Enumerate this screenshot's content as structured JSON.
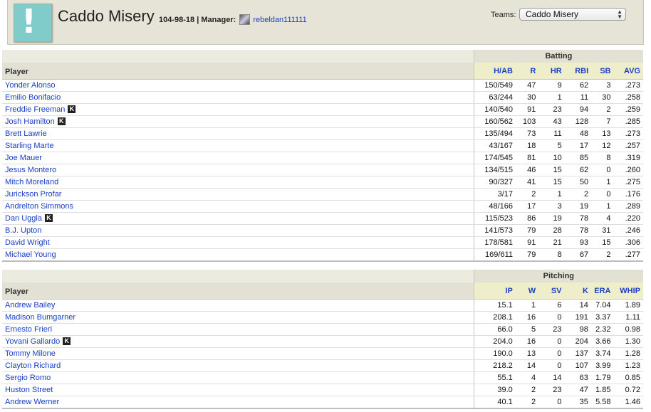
{
  "header": {
    "team_name": "Caddo Misery",
    "record": "104-98-18",
    "separator": "|",
    "manager_label": "Manager:",
    "manager_name": "rebeldan111111",
    "logo_glyph": "!",
    "teams_label": "Teams:",
    "teams_selected": "Caddo Misery"
  },
  "batting": {
    "group_label": "Batting",
    "player_header": "Player",
    "columns": [
      "H/AB",
      "R",
      "HR",
      "RBI",
      "SB",
      "AVG"
    ],
    "rows": [
      {
        "name": "Yonder Alonso",
        "k": false,
        "stats": [
          "150/549",
          "47",
          "9",
          "62",
          "3",
          ".273"
        ]
      },
      {
        "name": "Emilio Bonifacio",
        "k": false,
        "stats": [
          "63/244",
          "30",
          "1",
          "11",
          "30",
          ".258"
        ]
      },
      {
        "name": "Freddie Freeman",
        "k": true,
        "stats": [
          "140/540",
          "91",
          "23",
          "94",
          "2",
          ".259"
        ]
      },
      {
        "name": "Josh Hamilton",
        "k": true,
        "stats": [
          "160/562",
          "103",
          "43",
          "128",
          "7",
          ".285"
        ]
      },
      {
        "name": "Brett Lawrie",
        "k": false,
        "stats": [
          "135/494",
          "73",
          "11",
          "48",
          "13",
          ".273"
        ]
      },
      {
        "name": "Starling Marte",
        "k": false,
        "stats": [
          "43/167",
          "18",
          "5",
          "17",
          "12",
          ".257"
        ]
      },
      {
        "name": "Joe Mauer",
        "k": false,
        "stats": [
          "174/545",
          "81",
          "10",
          "85",
          "8",
          ".319"
        ]
      },
      {
        "name": "Jesus Montero",
        "k": false,
        "stats": [
          "134/515",
          "46",
          "15",
          "62",
          "0",
          ".260"
        ]
      },
      {
        "name": "Mitch Moreland",
        "k": false,
        "stats": [
          "90/327",
          "41",
          "15",
          "50",
          "1",
          ".275"
        ]
      },
      {
        "name": "Jurickson Profar",
        "k": false,
        "stats": [
          "3/17",
          "2",
          "1",
          "2",
          "0",
          ".176"
        ]
      },
      {
        "name": "Andrelton Simmons",
        "k": false,
        "stats": [
          "48/166",
          "17",
          "3",
          "19",
          "1",
          ".289"
        ]
      },
      {
        "name": "Dan Uggla",
        "k": true,
        "stats": [
          "115/523",
          "86",
          "19",
          "78",
          "4",
          ".220"
        ]
      },
      {
        "name": "B.J. Upton",
        "k": false,
        "stats": [
          "141/573",
          "79",
          "28",
          "78",
          "31",
          ".246"
        ]
      },
      {
        "name": "David Wright",
        "k": false,
        "stats": [
          "178/581",
          "91",
          "21",
          "93",
          "15",
          ".306"
        ]
      },
      {
        "name": "Michael Young",
        "k": false,
        "stats": [
          "169/611",
          "79",
          "8",
          "67",
          "2",
          ".277"
        ]
      }
    ]
  },
  "pitching": {
    "group_label": "Pitching",
    "player_header": "Player",
    "columns": [
      "IP",
      "W",
      "SV",
      "K",
      "ERA",
      "WHIP"
    ],
    "rows": [
      {
        "name": "Andrew Bailey",
        "k": false,
        "stats": [
          "15.1",
          "1",
          "6",
          "14",
          "7.04",
          "1.89"
        ]
      },
      {
        "name": "Madison Bumgarner",
        "k": false,
        "stats": [
          "208.1",
          "16",
          "0",
          "191",
          "3.37",
          "1.11"
        ]
      },
      {
        "name": "Ernesto Frieri",
        "k": false,
        "stats": [
          "66.0",
          "5",
          "23",
          "98",
          "2.32",
          "0.98"
        ]
      },
      {
        "name": "Yovani Gallardo",
        "k": true,
        "stats": [
          "204.0",
          "16",
          "0",
          "204",
          "3.66",
          "1.30"
        ]
      },
      {
        "name": "Tommy Milone",
        "k": false,
        "stats": [
          "190.0",
          "13",
          "0",
          "137",
          "3.74",
          "1.28"
        ]
      },
      {
        "name": "Clayton Richard",
        "k": false,
        "stats": [
          "218.2",
          "14",
          "0",
          "107",
          "3.99",
          "1.23"
        ]
      },
      {
        "name": "Sergio Romo",
        "k": false,
        "stats": [
          "55.1",
          "4",
          "14",
          "63",
          "1.79",
          "0.85"
        ]
      },
      {
        "name": "Huston Street",
        "k": false,
        "stats": [
          "39.0",
          "2",
          "23",
          "47",
          "1.85",
          "0.72"
        ]
      },
      {
        "name": "Andrew Werner",
        "k": false,
        "stats": [
          "40.1",
          "2",
          "0",
          "35",
          "5.58",
          "1.46"
        ]
      }
    ]
  },
  "k_badge_label": "K"
}
